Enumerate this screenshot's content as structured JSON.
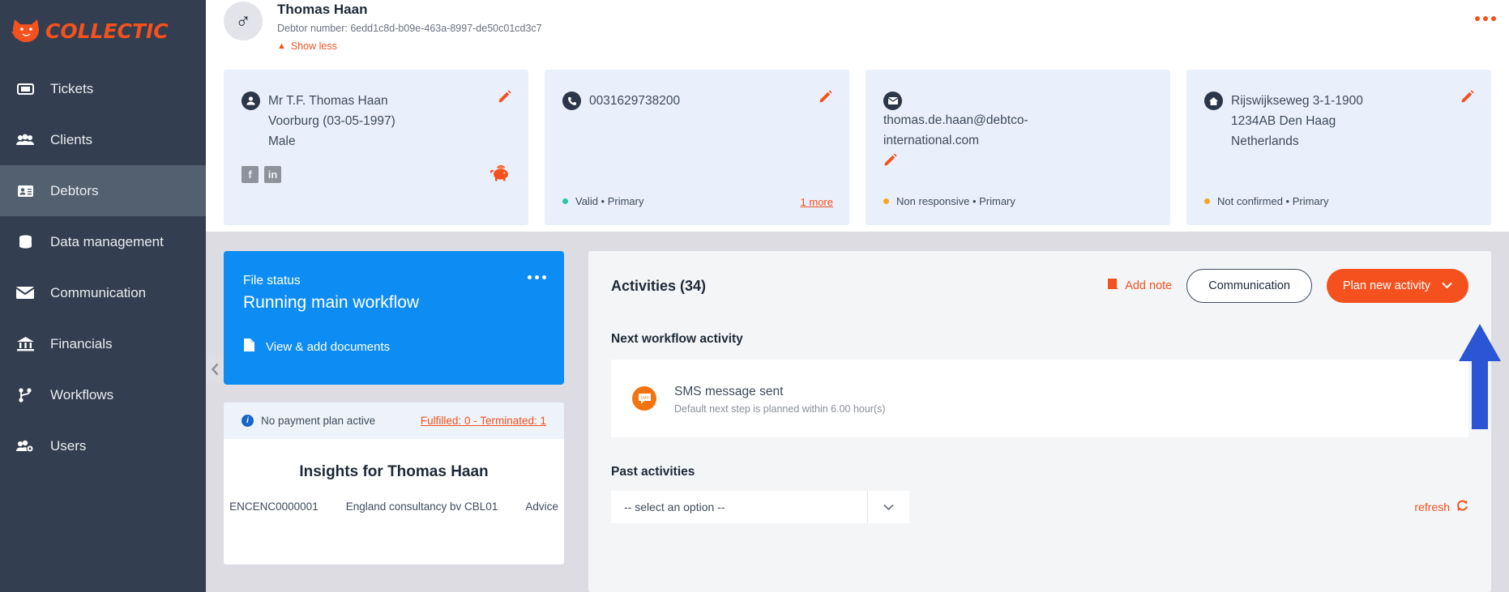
{
  "brand": {
    "name": "COLLECTIC",
    "accent": "#f4511e",
    "logo_icon": "fox-logo-icon"
  },
  "sidebar": {
    "items": [
      {
        "label": "Tickets",
        "icon": "ticket-icon",
        "active": false
      },
      {
        "label": "Clients",
        "icon": "users-group-icon",
        "active": false
      },
      {
        "label": "Debtors",
        "icon": "id-card-icon",
        "active": true
      },
      {
        "label": "Data management",
        "icon": "database-icon",
        "active": false
      },
      {
        "label": "Communication",
        "icon": "envelope-icon",
        "active": false
      },
      {
        "label": "Financials",
        "icon": "bank-icon",
        "active": false
      },
      {
        "label": "Workflows",
        "icon": "workflow-branch-icon",
        "active": false
      },
      {
        "label": "Users",
        "icon": "users-cog-icon",
        "active": false
      }
    ],
    "collapse_icon": "chevron-left-icon"
  },
  "debtor": {
    "name": "Thomas Haan",
    "number_label": "Debtor number: 6edd1c8d-b09e-463a-8997-de50c01cd3c7",
    "show_less": "Show less",
    "gender_glyph": "♂",
    "overflow_icon": "ellipsis-icon"
  },
  "cards": [
    {
      "icon": "person-icon",
      "lines": [
        "Mr T.F. Thomas Haan",
        "Voorburg (03-05-1997)",
        "Male"
      ],
      "status": "",
      "status_color": "",
      "more": "",
      "socials": [
        "f",
        "in"
      ],
      "piggy_icon": "piggy-bank-icon",
      "edit_icon": "pencil-icon"
    },
    {
      "icon": "phone-icon",
      "lines": [
        "0031629738200"
      ],
      "status": "Valid • Primary",
      "status_color": "green",
      "more": "1 more",
      "edit_icon": "pencil-icon"
    },
    {
      "icon": "envelope-icon",
      "lines": [
        "thomas.de.haan@debtco-",
        "international.com"
      ],
      "status": "Non responsive • Primary",
      "status_color": "amber",
      "more": "",
      "edit_icon": "pencil-icon"
    },
    {
      "icon": "home-icon",
      "lines": [
        "Rijswijkseweg 3-1-1900",
        "1234AB Den Haag",
        "Netherlands"
      ],
      "status": "Not confirmed • Primary",
      "status_color": "amber",
      "more": "",
      "edit_icon": "pencil-icon"
    }
  ],
  "file_status": {
    "label": "File status",
    "value": "Running main workflow",
    "documents_link": "View & add documents",
    "doc_icon": "document-icon",
    "overflow_icon": "ellipsis-icon",
    "bg_color": "#0d8df3"
  },
  "payment_plan": {
    "text": "No payment plan active",
    "link": "Fulfilled: 0 - Terminated: 1",
    "info_icon": "info-icon"
  },
  "insights": {
    "title": "Insights for Thomas Haan",
    "columns": [
      "ENCENC0000001",
      "England consultancy bv CBL01",
      "Advice"
    ]
  },
  "activities": {
    "title": "Activities (34)",
    "add_note": "Add note",
    "add_note_icon": "note-icon",
    "communication_button": "Communication",
    "plan_button": "Plan new activity",
    "plan_caret_icon": "chevron-down-icon",
    "next_heading": "Next workflow activity",
    "next_item": {
      "title": "SMS message sent",
      "subtitle": "Default next step is planned within 6.00 hour(s)",
      "icon": "sms-bubble-icon"
    },
    "past_heading": "Past activities",
    "select_value": "-- select an option --",
    "select_caret_icon": "chevron-down-icon",
    "refresh_label": "refresh",
    "refresh_icon": "refresh-icon"
  },
  "annotation": {
    "arrow_icon": "up-arrow-annotation",
    "color": "#2a55d4"
  }
}
